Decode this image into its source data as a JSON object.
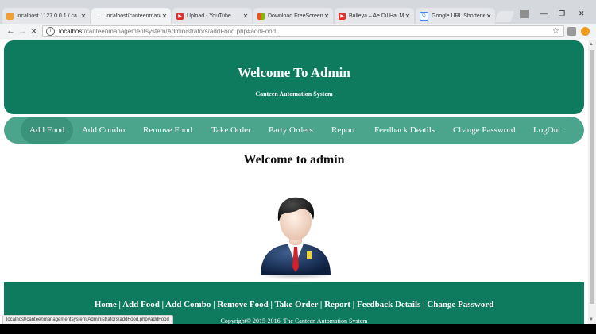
{
  "browser": {
    "tabs": [
      {
        "title": "localhost / 127.0.0.1 / ca",
        "icon": "phpmyadmin-icon",
        "color": "#f0a030"
      },
      {
        "title": "localhost/canteenmana",
        "icon": "loading-icon",
        "color": "#888888"
      },
      {
        "title": "Upload - YouTube",
        "icon": "youtube-icon",
        "color": "#e52d27"
      },
      {
        "title": "Download FreeScreenVi",
        "icon": "windows-icon",
        "color": "#3a8ee6"
      },
      {
        "title": "Bulleya – Ae Dil Hai Mu",
        "icon": "youtube-icon",
        "color": "#e52d27"
      },
      {
        "title": "Google URL Shortener",
        "icon": "google-icon",
        "color": "#4285f4"
      }
    ],
    "address": {
      "host": "localhost",
      "path": "/canteenmanagementsystem/Administrators/addFood.php#addFood"
    },
    "status_url": "localhost/canteenmanagementsystem/Administrators/addFood.php#addFood"
  },
  "header": {
    "title": "Welcome To Admin",
    "subtitle": "Canteen Automation System"
  },
  "menu": {
    "items": [
      "Add Food",
      "Add Combo",
      "Remove Food",
      "Take Order",
      "Party Orders",
      "Report",
      "Feedback Deatils",
      "Change Password",
      "LogOut"
    ],
    "active": "Add Food"
  },
  "main": {
    "welcome": "Welcome to admin"
  },
  "footer": {
    "links": "Home | Add Food | Add Combo | Remove Food | Take Order | Report | Feedback Details | Change Password",
    "copyright": "Copyright© 2015-2016, The Canteen Automation System"
  },
  "colors": {
    "header_bg": "#0e7a5e",
    "menu_bg": "#4aa58c"
  }
}
